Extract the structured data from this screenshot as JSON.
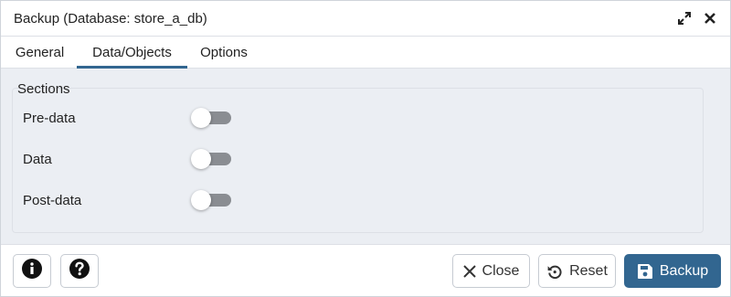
{
  "dialog": {
    "title": "Backup (Database: store_a_db)",
    "icons": {
      "expand": "expand-icon",
      "close": "close-x-icon"
    }
  },
  "tabs": [
    {
      "label": "General",
      "active": false
    },
    {
      "label": "Data/Objects",
      "active": true
    },
    {
      "label": "Options",
      "active": false
    }
  ],
  "sections": {
    "title": "Sections",
    "items": [
      {
        "label": "Pre-data",
        "enabled": false
      },
      {
        "label": "Data",
        "enabled": false
      },
      {
        "label": "Post-data",
        "enabled": false
      }
    ]
  },
  "footer": {
    "info_icon": "info-icon",
    "help_icon": "help-icon",
    "close_label": "Close",
    "reset_label": "Reset",
    "backup_label": "Backup"
  },
  "colors": {
    "accent": "#326690",
    "panel_bg": "#ebeef3",
    "toggle_off": "#8a8d92"
  }
}
